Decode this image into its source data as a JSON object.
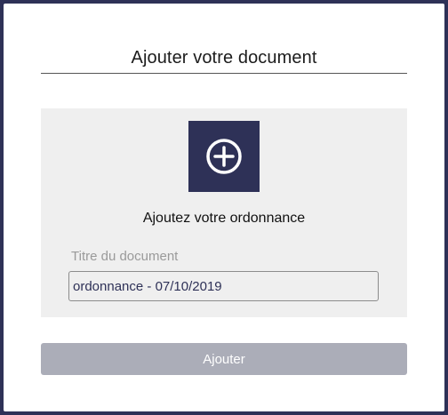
{
  "dialog": {
    "title": "Ajouter votre document"
  },
  "upload": {
    "icon": "plus-circle-icon",
    "caption": "Ajoutez votre ordonnance"
  },
  "document_title_field": {
    "label": "Titre du document",
    "value": "ordonnance - 07/10/2019"
  },
  "submit": {
    "label": "Ajouter"
  },
  "colors": {
    "brand": "#2e3157",
    "panel": "#efefef",
    "submit_disabled": "#abadb8"
  }
}
